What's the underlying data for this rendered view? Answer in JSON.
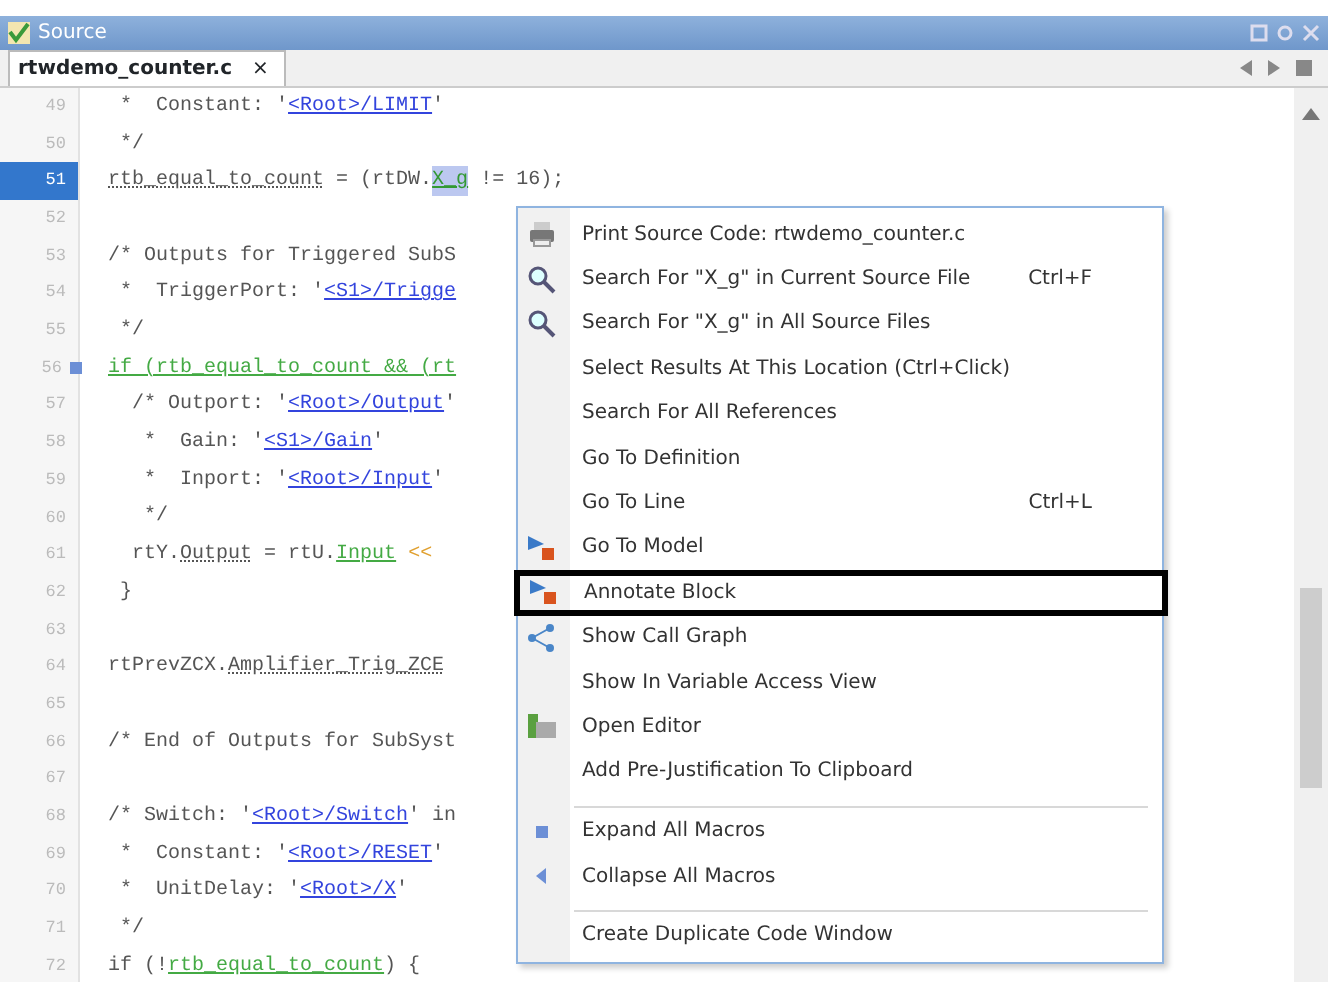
{
  "window": {
    "title": "Source"
  },
  "tabs": [
    {
      "label": "rtwdemo_counter.c",
      "close": "×",
      "selected": true
    }
  ],
  "code": {
    "lines": [
      {
        "number": "49",
        "selected": false,
        "fold_marker": false,
        "segments": [
          {
            "kind": "plain",
            "text": " *  Constant: '"
          },
          {
            "kind": "link",
            "text": "<Root>/LIMIT"
          },
          {
            "kind": "plain",
            "text": "'"
          }
        ]
      },
      {
        "number": "50",
        "selected": false,
        "fold_marker": false,
        "segments": [
          {
            "kind": "plain",
            "text": " */"
          }
        ]
      },
      {
        "number": "51",
        "selected": true,
        "fold_marker": false,
        "segments": [
          {
            "kind": "var",
            "text": "rtb_equal_to_count"
          },
          {
            "kind": "plain",
            "text": " = (rtDW."
          },
          {
            "kind": "highlight",
            "text": "X_g"
          },
          {
            "kind": "plain",
            "text": " != 16);"
          }
        ]
      },
      {
        "number": "52",
        "selected": false,
        "fold_marker": false
      },
      {
        "number": "53",
        "selected": false,
        "fold_marker": false,
        "segments": [
          {
            "kind": "plain",
            "text": "/* Outputs for Triggered SubS"
          }
        ]
      },
      {
        "number": "54",
        "selected": false,
        "fold_marker": false,
        "segments": [
          {
            "kind": "plain",
            "text": " *  TriggerPort: '"
          },
          {
            "kind": "link",
            "text": "<S1>/Trigge"
          }
        ]
      },
      {
        "number": "55",
        "selected": false,
        "fold_marker": false,
        "segments": [
          {
            "kind": "plain",
            "text": " */"
          }
        ]
      },
      {
        "number": "56",
        "selected": false,
        "fold_marker": true,
        "segments": [
          {
            "kind": "green",
            "text": "if (rtb_equal_to_count && (rt"
          }
        ]
      },
      {
        "number": "57",
        "selected": false,
        "fold_marker": false,
        "segments": [
          {
            "kind": "plain",
            "text": "  /* Outport: '"
          },
          {
            "kind": "link",
            "text": "<Root>/Output"
          },
          {
            "kind": "plain",
            "text": "'"
          }
        ]
      },
      {
        "number": "58",
        "selected": false,
        "fold_marker": false,
        "segments": [
          {
            "kind": "plain",
            "text": "   *  Gain: '"
          },
          {
            "kind": "link",
            "text": "<S1>/Gain"
          },
          {
            "kind": "plain",
            "text": "'"
          }
        ]
      },
      {
        "number": "59",
        "selected": false,
        "fold_marker": false,
        "segments": [
          {
            "kind": "plain",
            "text": "   *  Inport: '"
          },
          {
            "kind": "link",
            "text": "<Root>/Input"
          },
          {
            "kind": "plain",
            "text": "'"
          }
        ]
      },
      {
        "number": "60",
        "selected": false,
        "fold_marker": false,
        "segments": [
          {
            "kind": "plain",
            "text": "   */"
          }
        ]
      },
      {
        "number": "61",
        "selected": false,
        "fold_marker": false,
        "segments": [
          {
            "kind": "plain",
            "text": "  rtY."
          },
          {
            "kind": "var",
            "text": "Output"
          },
          {
            "kind": "plain",
            "text": " = rtU."
          },
          {
            "kind": "green",
            "text": "Input"
          },
          {
            "kind": "operator",
            "text": "<<"
          }
        ]
      },
      {
        "number": "62",
        "selected": false,
        "fold_marker": false,
        "segments": [
          {
            "kind": "plain",
            "text": " }"
          }
        ]
      },
      {
        "number": "63",
        "selected": false,
        "fold_marker": false
      },
      {
        "number": "64",
        "selected": false,
        "fold_marker": false,
        "segments": [
          {
            "kind": "plain",
            "text": "rtPrevZCX."
          },
          {
            "kind": "var",
            "text": "Amplifier_Trig_ZCE"
          }
        ]
      },
      {
        "number": "65",
        "selected": false,
        "fold_marker": false
      },
      {
        "number": "66",
        "selected": false,
        "fold_marker": false,
        "segments": [
          {
            "kind": "plain",
            "text": "/* End of Outputs for SubSyst"
          }
        ]
      },
      {
        "number": "67",
        "selected": false,
        "fold_marker": false
      },
      {
        "number": "68",
        "selected": false,
        "fold_marker": false,
        "segments": [
          {
            "kind": "plain",
            "text": "/* Switch: '"
          },
          {
            "kind": "link",
            "text": "<Root>/Switch"
          },
          {
            "kind": "plain",
            "text": "' in"
          }
        ]
      },
      {
        "number": "69",
        "selected": false,
        "fold_marker": false,
        "segments": [
          {
            "kind": "plain",
            "text": " *  Constant: '"
          },
          {
            "kind": "link",
            "text": "<Root>/RESET"
          },
          {
            "kind": "plain",
            "text": "'"
          }
        ]
      },
      {
        "number": "70",
        "selected": false,
        "fold_marker": false,
        "segments": [
          {
            "kind": "plain",
            "text": " *  UnitDelay: '"
          },
          {
            "kind": "link",
            "text": "<Root>/X"
          },
          {
            "kind": "plain",
            "text": "'"
          }
        ]
      },
      {
        "number": "71",
        "selected": false,
        "fold_marker": false,
        "segments": [
          {
            "kind": "plain",
            "text": " */"
          }
        ]
      },
      {
        "number": "72",
        "selected": false,
        "fold_marker": false,
        "segments": [
          {
            "kind": "plain",
            "text": "if (!"
          },
          {
            "kind": "green",
            "text": "rtb_equal_to_count"
          },
          {
            "kind": "plain",
            "text": ") {"
          }
        ]
      }
    ]
  },
  "context_menu": {
    "items": [
      {
        "label": "Print Source Code: rtwdemo_counter.c",
        "kind": "printer",
        "selected": false,
        "separator_before": false
      },
      {
        "label": "Search For \"X_g\" in Current Source File",
        "shortcut": "Ctrl+F",
        "kind": "search",
        "selected": false,
        "separator_before": false
      },
      {
        "label": "Search For \"X_g\" in All Source Files",
        "kind": "search",
        "selected": false,
        "separator_before": false
      },
      {
        "label": "Select Results At This Location (Ctrl+Click)",
        "selected": false,
        "separator_before": false
      },
      {
        "label": "Search For All References",
        "selected": false,
        "separator_before": false
      },
      {
        "label": "Go To Definition",
        "selected": false,
        "separator_before": false
      },
      {
        "label": "Go To Line",
        "shortcut": "Ctrl+L",
        "selected": false,
        "separator_before": false
      },
      {
        "label": "Go To Model",
        "kind": "model",
        "selected": false,
        "separator_before": false
      },
      {
        "label": "Annotate Block",
        "kind": "model",
        "selected": true,
        "separator_before": false
      },
      {
        "label": "Show Call Graph",
        "kind": "graph",
        "selected": false,
        "separator_before": false
      },
      {
        "label": "Show In Variable Access View",
        "selected": false,
        "separator_before": false
      },
      {
        "label": "Open Editor",
        "kind": "editor",
        "selected": false,
        "separator_before": false
      },
      {
        "label": "Add Pre-Justification To Clipboard",
        "selected": false,
        "separator_before": false
      },
      {
        "label": "Expand All Macros",
        "kind": "expand",
        "selected": false,
        "separator_before": true
      },
      {
        "label": "Collapse All Macros",
        "kind": "collapse",
        "selected": false,
        "separator_before": false
      },
      {
        "label": "Create Duplicate Code Window",
        "selected": false,
        "separator_before": true
      }
    ]
  }
}
